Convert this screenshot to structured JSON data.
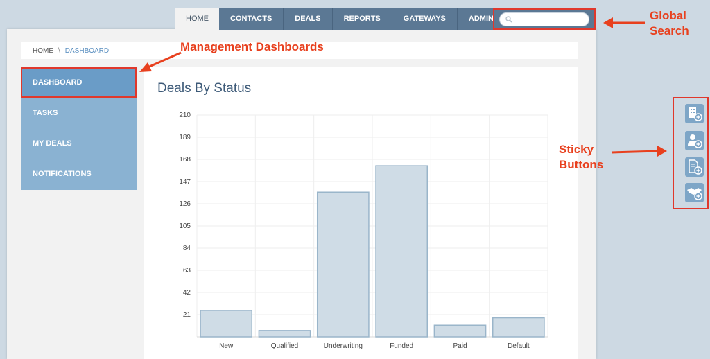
{
  "nav": {
    "tabs": [
      "HOME",
      "CONTACTS",
      "DEALS",
      "REPORTS",
      "GATEWAYS",
      "ADMIN"
    ],
    "active": "HOME"
  },
  "search": {
    "placeholder": ""
  },
  "breadcrumb": {
    "home": "HOME",
    "sep": "\\",
    "current": "DASHBOARD"
  },
  "sidebar": {
    "items": [
      {
        "label": "DASHBOARD",
        "active": true
      },
      {
        "label": "TASKS"
      },
      {
        "label": "MY DEALS"
      },
      {
        "label": "NOTIFICATIONS"
      }
    ]
  },
  "annotations": {
    "management": "Management Dashboards",
    "global_search_1": "Global",
    "global_search_2": "Search",
    "sticky_1": "Sticky",
    "sticky_2": "Buttons"
  },
  "sticky_buttons": [
    "add-company-icon",
    "add-contact-icon",
    "add-document-icon",
    "add-deal-icon"
  ],
  "colors": {
    "nav": "#5b7894",
    "sidebar": "#8ab2d2",
    "bar": "#cfdce6",
    "annotation": "#e8401e"
  },
  "chart_data": {
    "type": "bar",
    "title": "Deals By Status",
    "categories": [
      "New",
      "Qualified",
      "Underwriting",
      "Funded",
      "Paid",
      "Default"
    ],
    "values": [
      25,
      6,
      137,
      162,
      11,
      18
    ],
    "yticks": [
      21,
      42,
      63,
      84,
      105,
      126,
      147,
      168,
      189,
      210
    ],
    "ylim": [
      0,
      210
    ],
    "grid": true
  }
}
